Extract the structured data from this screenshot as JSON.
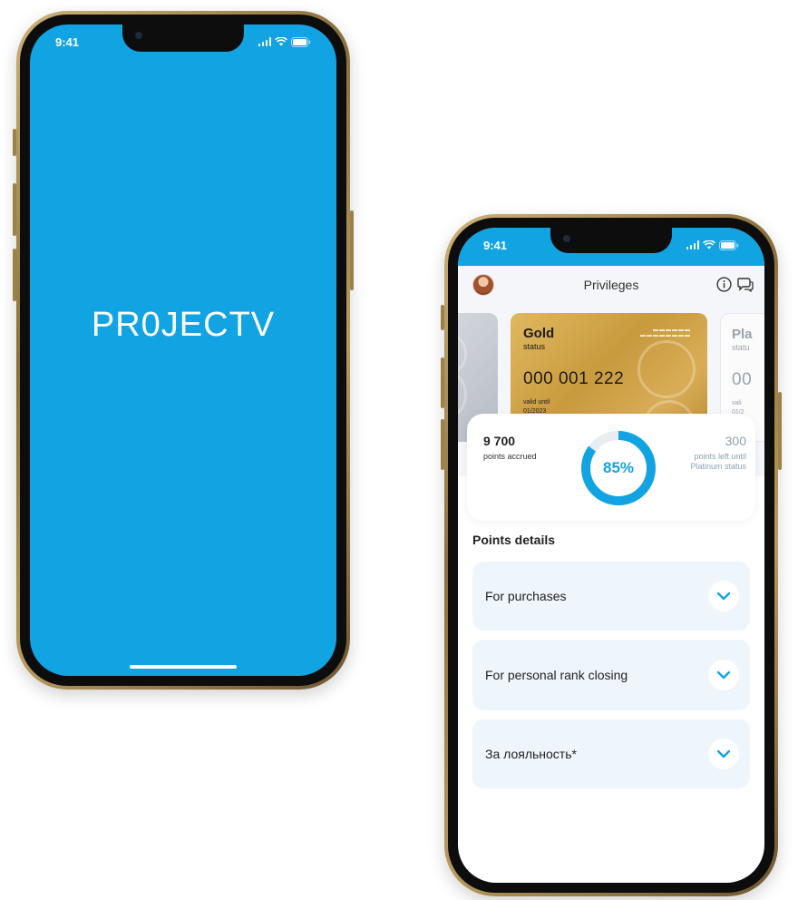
{
  "status_bar": {
    "time": "9:41"
  },
  "splash": {
    "logo_text": "PR0JECTV",
    "bg_color": "#12a3e3"
  },
  "header": {
    "title": "Privileges"
  },
  "cards": {
    "gold": {
      "level": "Gold",
      "subtitle": "status",
      "number": "000 001 222",
      "valid_label": "valid until",
      "valid_date": "01/2023"
    },
    "platinum": {
      "level": "Pla",
      "subtitle": "statu",
      "number": "00",
      "valid_label": "vali",
      "valid_date": "01/2"
    }
  },
  "points": {
    "accrued_value": "9 700",
    "accrued_label": "points accrued",
    "progress_label": "85%",
    "progress_fraction": 0.85,
    "left_value": "300",
    "left_label": "points left until Platinum status"
  },
  "points_details": {
    "title": "Points details",
    "items": [
      {
        "label": "For purchases"
      },
      {
        "label": "For personal rank closing"
      },
      {
        "label": "За лояльность*"
      }
    ]
  },
  "colors": {
    "accent": "#12a3e3",
    "gold": "#d4a84a",
    "row_bg": "#eef5fb"
  }
}
